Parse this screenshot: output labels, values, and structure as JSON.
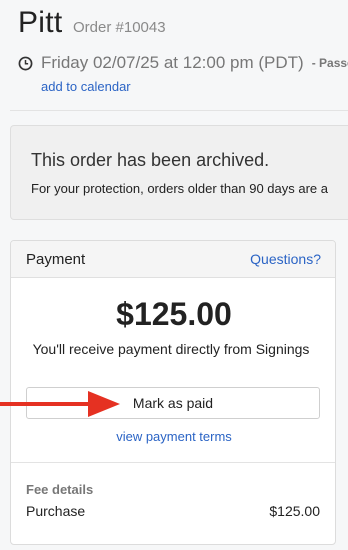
{
  "header": {
    "name": "Pitt",
    "order_number": "Order #10043"
  },
  "appointment": {
    "datetime": "Friday 02/07/25 at 12:00 pm (PDT)",
    "status": "- Passed",
    "add_to_calendar": "add to calendar"
  },
  "archive_notice": {
    "title": "This order has been archived.",
    "body": "For your protection, orders older than 90 days are a"
  },
  "payment": {
    "title": "Payment",
    "questions_link": "Questions?",
    "amount": "$125.00",
    "note": "You'll receive payment directly from Signings",
    "mark_paid_button": "Mark as paid",
    "terms_link": "view payment terms",
    "fee_details": {
      "heading": "Fee details",
      "rows": [
        {
          "label": "Purchase",
          "value": "$125.00"
        }
      ]
    }
  },
  "colors": {
    "link": "#2b64c5",
    "annotation_arrow": "#e53122"
  },
  "icons": {
    "clock": "clock-icon",
    "arrow": "red-arrow-annotation"
  }
}
